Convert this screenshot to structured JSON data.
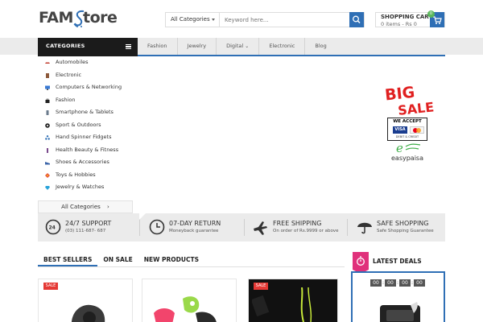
{
  "header": {
    "logo_left": "FAM",
    "logo_right": "tore",
    "category_select": "All Categories",
    "search_placeholder": "Keyword here...",
    "cart_title": "SHOPPING CART",
    "cart_summary": "0 items - Rs 0",
    "cart_count": "0"
  },
  "nav": {
    "categories_label": "CATEGORIES",
    "items": [
      {
        "label": "Fashion"
      },
      {
        "label": "Jewelry"
      },
      {
        "label": "Digital"
      },
      {
        "label": "Electronic"
      },
      {
        "label": "Blog"
      }
    ]
  },
  "categories": [
    {
      "label": "Automobiles",
      "icon": "car-icon"
    },
    {
      "label": "Electronic",
      "icon": "electronic-icon"
    },
    {
      "label": "Computers & Networking",
      "icon": "monitor-icon"
    },
    {
      "label": "Fashion",
      "icon": "bag-icon"
    },
    {
      "label": "Smartphone & Tablets",
      "icon": "phone-icon"
    },
    {
      "label": "Sport & Outdoors",
      "icon": "ball-icon"
    },
    {
      "label": "Hand Spinner Fidgets",
      "icon": "spinner-icon"
    },
    {
      "label": "Health Beauty & Fitness",
      "icon": "bottle-icon"
    },
    {
      "label": "Shoes & Accessories",
      "icon": "shoe-icon"
    },
    {
      "label": "Toys & Hobbies",
      "icon": "toy-icon"
    },
    {
      "label": "Jewelry & Watches",
      "icon": "diamond-icon"
    }
  ],
  "all_categories": "All Categories",
  "promo": {
    "big_sale_top": "BIG",
    "big_sale_bottom": "SALE",
    "we_accept": "WE ACCEPT",
    "visa": "VISA",
    "card_sub": "DEBIT & CREDIT",
    "easypaisa": "easypaisa"
  },
  "features": [
    {
      "title": "24/7 SUPPORT",
      "subtitle": "(03) 111-687- 687",
      "icon": "phone-24-icon"
    },
    {
      "title": "07-DAY RETURN",
      "subtitle": "Moneyback guarantee",
      "icon": "clock-icon"
    },
    {
      "title": "FREE SHIPPING",
      "subtitle": "On order of Rs.9999 or above",
      "icon": "plane-icon"
    },
    {
      "title": "SAFE SHOPPING",
      "subtitle": "Safe Shopping Guarantee",
      "icon": "umbrella-icon"
    }
  ],
  "tabs": [
    {
      "label": "BEST SELLERS",
      "active": true
    },
    {
      "label": "ON SALE"
    },
    {
      "label": "NEW PRODUCTS"
    }
  ],
  "sale_badge": "SALE",
  "latest_deals": {
    "title": "LATEST DEALS",
    "timer": [
      "00",
      "00",
      "00",
      "00"
    ]
  },
  "colors": {
    "accent": "#2f6fb5",
    "dark": "#1b1b1b",
    "sale": "#e53935",
    "deals": "#e0317b"
  }
}
